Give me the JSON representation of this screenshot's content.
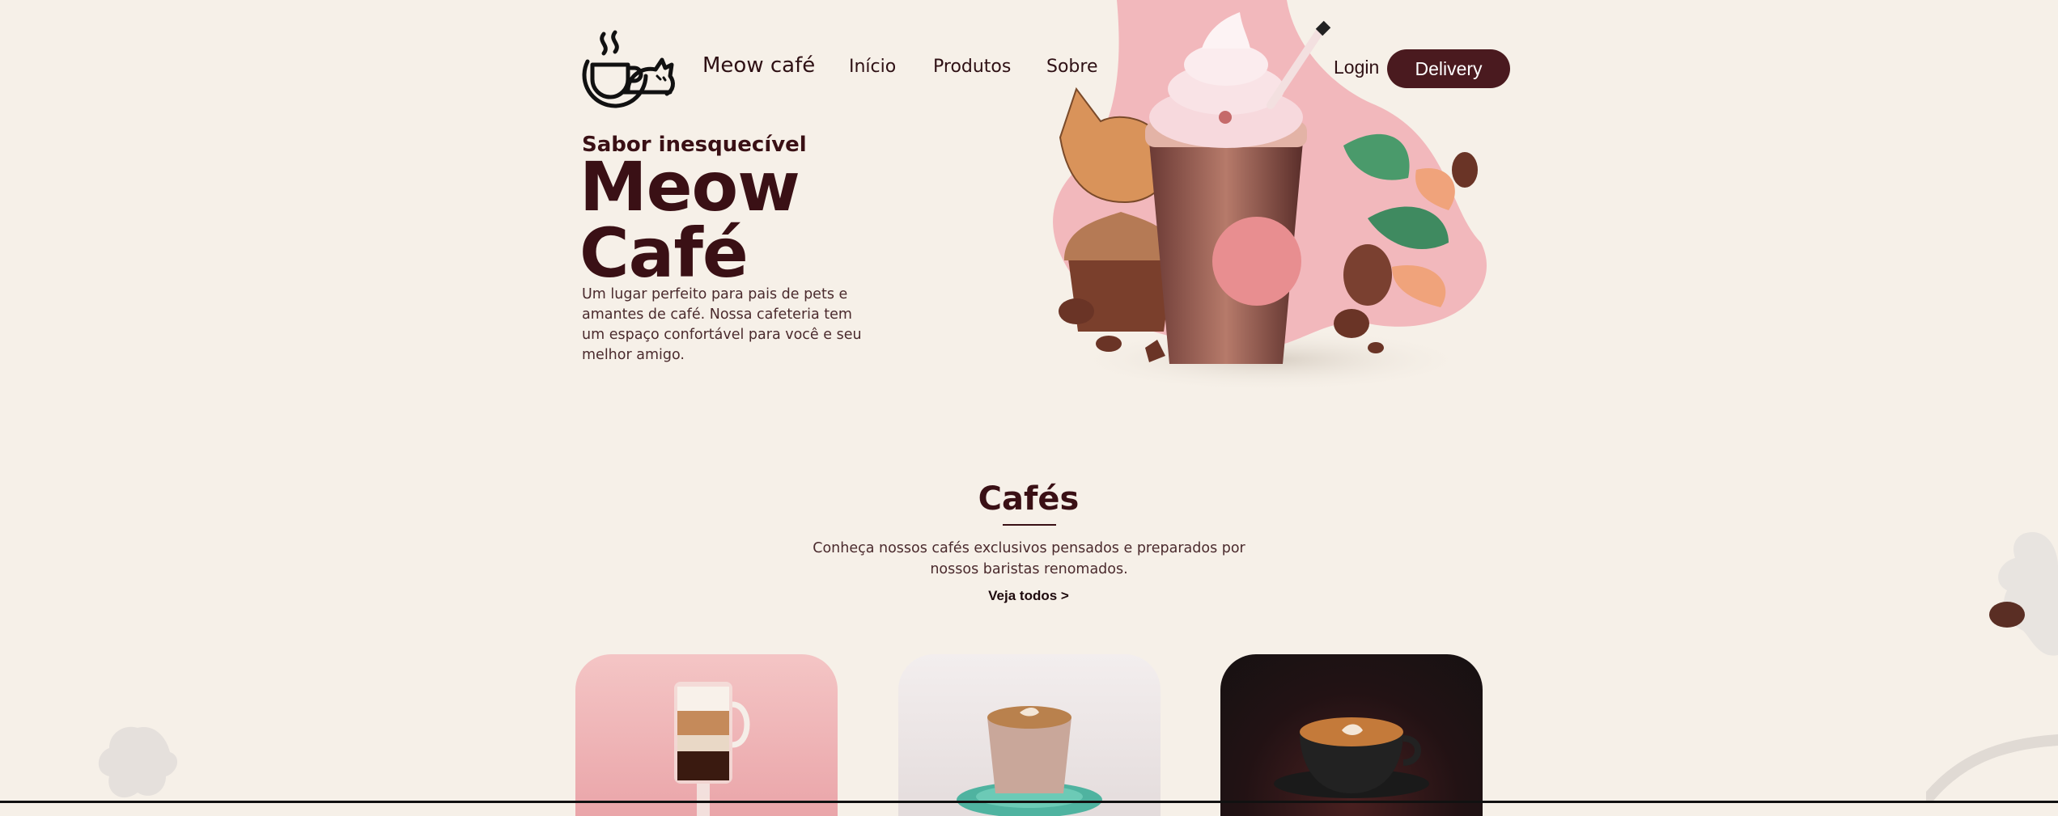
{
  "header": {
    "brand": "Meow café",
    "nav": [
      "Início",
      "Produtos",
      "Sobre"
    ],
    "login": "Login",
    "delivery": "Delivery"
  },
  "hero": {
    "tagline": "Sabor inesquecível",
    "title_line1": "Meow",
    "title_line2": "Café",
    "description": "Um lugar perfeito para pais de pets e amantes de café. Nossa cafeteria tem um espaço confortável para você e seu melhor amigo."
  },
  "cafes": {
    "title": "Cafés",
    "description": "Conheça nossos cafés exclusivos pensados e preparados por nossos baristas renomados.",
    "see_all": "Veja todos >"
  },
  "icons": {
    "logo": "cat-coffee-cup-icon"
  },
  "colors": {
    "background": "#f6f0e8",
    "primary": "#4a1a1f",
    "text": "#3a1015",
    "accent_pink": "#f2b8bc"
  }
}
